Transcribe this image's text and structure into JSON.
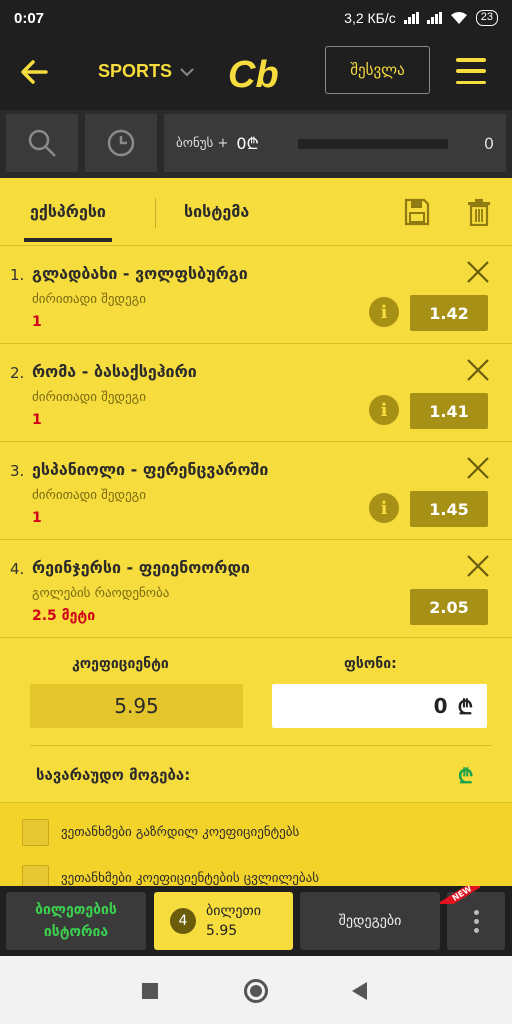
{
  "status": {
    "time": "0:07",
    "net_speed": "3,2 КБ/с",
    "battery": "23"
  },
  "header": {
    "sports_label": "SPORTS",
    "logo_text": "Cb",
    "login_label": "შესვლა"
  },
  "tools": {
    "bonus_label": "ბონუს +",
    "bonus_amount": "0₾",
    "bonus_count": "0"
  },
  "tabs": {
    "express": "ექსპრესი",
    "system": "სისტემა"
  },
  "bets": [
    {
      "num": "1.",
      "match": "გლადბახი - ვოლფსბურგი",
      "market": "ძირითადი შედეგი",
      "outcome": "1",
      "odd": "1.42",
      "info": "i"
    },
    {
      "num": "2.",
      "match": "რომა - ბასაქსეჰირი",
      "market": "ძირითადი შედეგი",
      "outcome": "1",
      "odd": "1.41",
      "info": "i"
    },
    {
      "num": "3.",
      "match": "ესპანიოლი - ფერენცვაროში",
      "market": "ძირითადი შედეგი",
      "outcome": "1",
      "odd": "1.45",
      "info": "i"
    },
    {
      "num": "4.",
      "match": "რეინჯერსი - ფეიენოორდი",
      "market": "გოლების რაოდენობა",
      "outcome": "2.5 მეტი",
      "odd": "2.05"
    }
  ],
  "summary": {
    "coef_label": "კოეფიციენტი",
    "coef_value": "5.95",
    "stake_label": "ფსონი:",
    "stake_value": "0",
    "currency": "₾",
    "possible_win_label": "სავარაუდო მოგება:"
  },
  "options": [
    "ვეთანხმები გაზრდილ კოეფიციენტებს",
    "ვეთანხმები კოეფიციენტების ცვლილებას"
  ],
  "bottom": {
    "history_line1": "ბილეთების",
    "history_line2": "ისტორია",
    "ticket_count": "4",
    "ticket_label": "ბილეთი",
    "ticket_value": "5.95",
    "results_label": "შედეგები",
    "new_tag": "NEW"
  },
  "colors": {
    "accent": "#f6dc3d",
    "dark": "#1f1f1f",
    "odd_bg": "#a69015",
    "outcome": "#d0021b",
    "history": "#3bd14f"
  }
}
